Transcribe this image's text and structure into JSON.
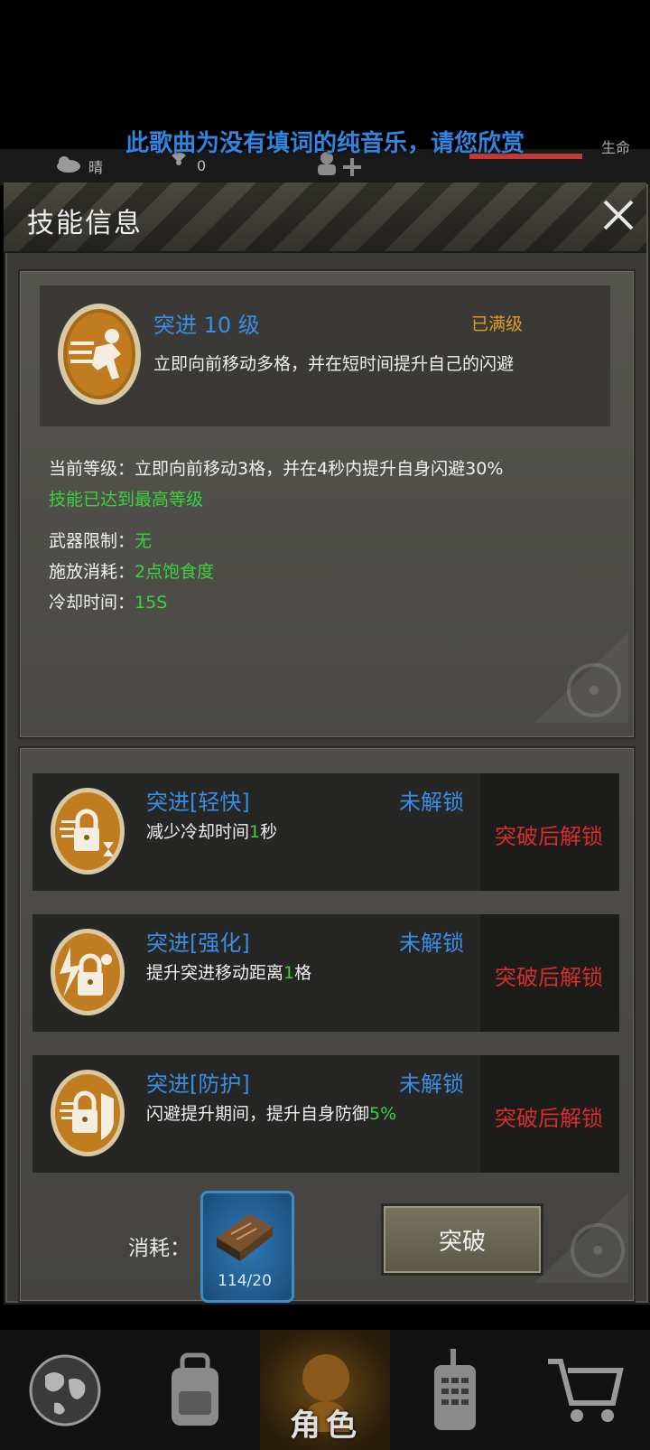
{
  "background": {
    "banner_text": "此歌曲为没有填词的纯音乐，请您欣赏",
    "weather_label": "晴",
    "radiation_value": "0",
    "life_label": "生命"
  },
  "dialog": {
    "title": "技能信息",
    "skill": {
      "name": "突进 10 级",
      "status": "已满级",
      "description": "立即向前移动多格，并在短时间提升自己的闪避"
    },
    "details": {
      "current_level": "当前等级：立即向前移动3格，并在4秒内提升自身闪避30%",
      "max_notice": "技能已达到最高等级",
      "weapon_label": "武器限制：",
      "weapon_value": "无",
      "cost_label": "施放消耗：",
      "cost_value": "2点饱食度",
      "cooldown_label": "冷却时间：",
      "cooldown_value": "15S"
    },
    "sub_skills": [
      {
        "name": "突进[轻快]",
        "state": "未解锁",
        "desc_prefix": "减少冷却时间",
        "desc_value": "1",
        "desc_suffix": "秒",
        "hint": "突破后解锁"
      },
      {
        "name": "突进[强化]",
        "state": "未解锁",
        "desc_prefix": "提升突进移动距离",
        "desc_value": "1",
        "desc_suffix": "格",
        "hint": "突破后解锁"
      },
      {
        "name": "突进[防护]",
        "state": "未解锁",
        "desc_prefix": "闪避提升期间，提升自身防御",
        "desc_value": "5%",
        "desc_suffix": "",
        "hint": "突破后解锁"
      }
    ],
    "consume_label": "消耗：",
    "consume_count": "114/20",
    "breakthrough_label": "突破"
  },
  "nav": {
    "active_label": "角色",
    "items": [
      "globe-icon",
      "backpack-icon",
      "character-icon",
      "radio-icon",
      "cart-icon"
    ]
  },
  "colors": {
    "accent_blue": "#3a8ee6",
    "maxed_orange": "#e39a2b",
    "value_green": "#39d43b",
    "locked_red": "#d42e2e"
  }
}
